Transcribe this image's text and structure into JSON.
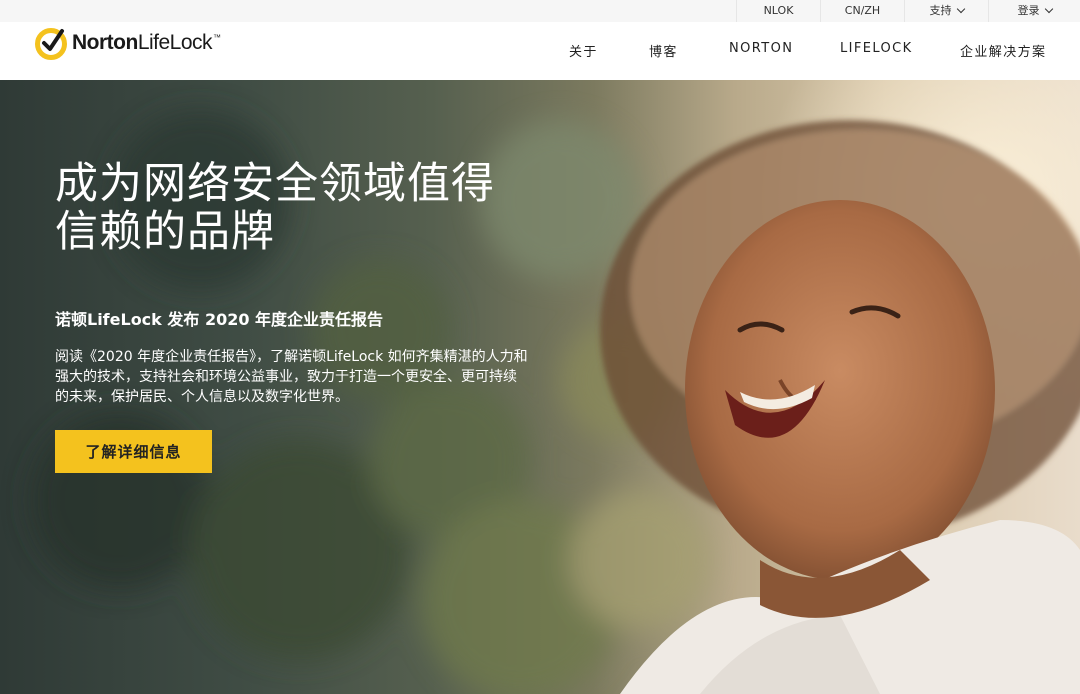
{
  "utility_bar": {
    "items": [
      {
        "label": "NLOK"
      },
      {
        "label": "CN/ZH"
      },
      {
        "label": "支持"
      },
      {
        "label": "登录"
      }
    ]
  },
  "header": {
    "logo": {
      "brand_bold": "Norton",
      "brand_regular": "LifeLock",
      "trademark": "™"
    },
    "nav": [
      {
        "label": "关于"
      },
      {
        "label": "博客"
      },
      {
        "label": "NORTON"
      },
      {
        "label": "LIFELOCK"
      },
      {
        "label": "企业解决方案"
      }
    ]
  },
  "hero": {
    "title_line1": "成为网络安全领域值得",
    "title_line2": "信赖的品牌",
    "subtitle": "诺顿LifeLock 发布 2020 年度企业责任报告",
    "body_line1": "阅读《2020 年度企业责任报告》，了解诺顿LifeLock 如何齐集精湛的人力和",
    "body_line2": "强大的技术，支持社会和环境公益事业，致力于打造一个更安全、更可持续",
    "body_line3": "的未来，保护居民、个人信息以及数字化世界。",
    "cta_label": "了解详细信息"
  },
  "colors": {
    "accent": "#f4c21e",
    "logo_ring": "#f4c21e",
    "text_dark": "#222222",
    "utility_bg": "#f6f6f6"
  },
  "icons": [
    "norton-checkmark-logo-icon",
    "chevron-down-icon"
  ]
}
